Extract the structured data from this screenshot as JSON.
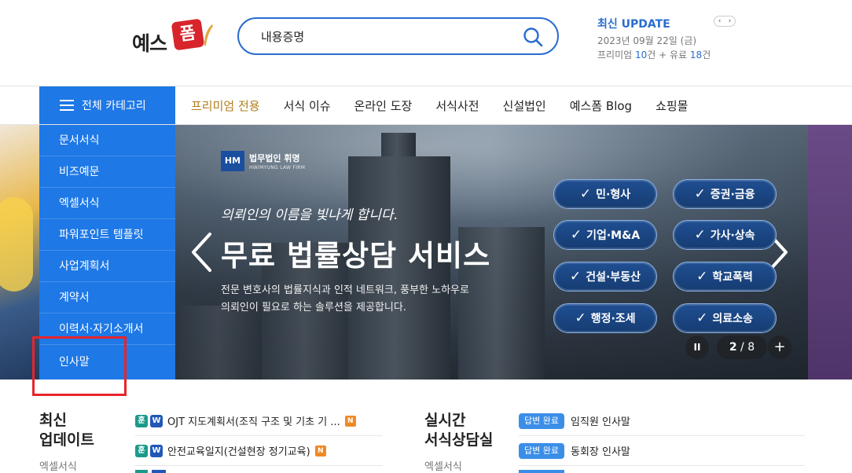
{
  "header": {
    "logo_text": "예스",
    "logo_mark": "폼",
    "search_value": "내용증명",
    "update_title": "최신 UPDATE",
    "update_date": "2023년 09월 22일 (금)",
    "update_counts": {
      "premium_label": "프리미엄",
      "premium_num": "10",
      "unit1": "건 + 유료",
      "paid_num": "18",
      "unit2": "건"
    },
    "update_nav": [
      "‹",
      "›"
    ]
  },
  "nav": {
    "category_button": "전체 카테고리",
    "items": [
      "프리미엄 전용",
      "서식 이슈",
      "온라인 도장",
      "서식사전",
      "신설법인",
      "예스폼 Blog",
      "쇼핑몰"
    ]
  },
  "sidebar": {
    "items": [
      "문서서식",
      "비즈예문",
      "엑셀서식",
      "파워포인트 템플릿",
      "사업계획서",
      "계약서",
      "이력서·자기소개서",
      "인사말"
    ]
  },
  "banner": {
    "firm_mark": "HM",
    "firm_name": "법무법인 휘명",
    "firm_name_en": "HWIMYUNG LAW FIRM",
    "slogan": "의뢰인의 이름을 빛나게 합니다.",
    "headline": "무료 법률상담 서비스",
    "desc": [
      "전문 변호사의 법률지식과 인적 네트워크, 풍부한 노하우로",
      "의뢰인이 필요로 하는 솔루션을 제공합니다."
    ],
    "pills": [
      "민·형사",
      "증권·금융",
      "기업·M&A",
      "가사·상속",
      "건설·부동산",
      "학교폭력",
      "행정·조세",
      "의료소송"
    ],
    "pause": "II",
    "page_current": "2",
    "page_sep": " / ",
    "page_total": "8",
    "plus": "+"
  },
  "latest": {
    "title_line1": "최신",
    "title_line2": "업데이트",
    "sub": "엑셀서식",
    "rows": [
      {
        "hun": "훈",
        "w": "W",
        "text": "OJT 지도계획서(조직 구조 및 기초 기 ...",
        "n": "N"
      },
      {
        "hun": "훈",
        "w": "W",
        "text": "안전교육일지(건설현장 정기교육)",
        "n": "N"
      }
    ]
  },
  "consult": {
    "title_line1": "실시간",
    "title_line2": "서식상담실",
    "sub": "엑셀서식",
    "rows": [
      {
        "badge": "답변 완료",
        "text": "임직원 인사말"
      },
      {
        "badge": "답변 완료",
        "text": "동회장 인사말"
      }
    ]
  },
  "colors": {
    "primary_blue": "#1e78e6",
    "accent_blue": "#2a6ccf",
    "brand_red": "#d8242b",
    "highlight_red": "#e8242b",
    "premium_gold": "#b07d1a"
  }
}
